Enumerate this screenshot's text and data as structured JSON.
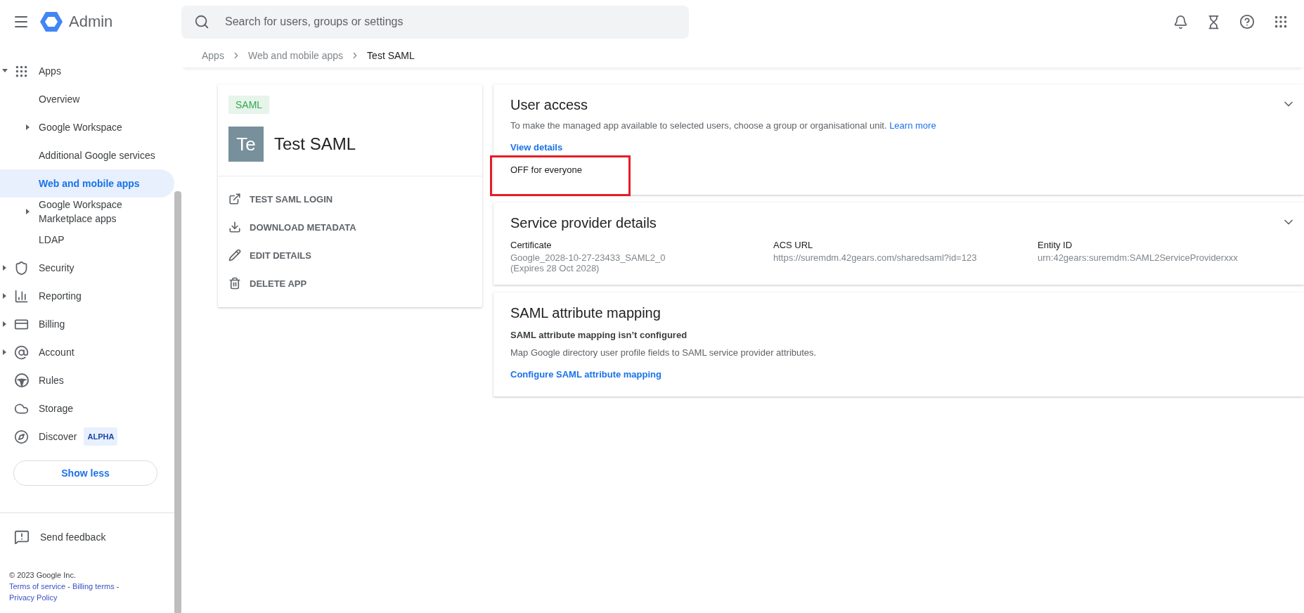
{
  "app_bar": {
    "product": "Admin",
    "search": {
      "placeholder": "Search for users, groups or settings"
    }
  },
  "sidebar": {
    "items": [
      {
        "label": "Apps",
        "kind": "grid",
        "expandable": true,
        "expanded": true,
        "selected": false,
        "children": [
          {
            "label": "Overview",
            "expandable": false,
            "selected": false
          },
          {
            "label": "Google Workspace",
            "expandable": true,
            "selected": false
          },
          {
            "label": "Additional Google services",
            "expandable": false,
            "selected": false
          },
          {
            "label": "Web and mobile apps",
            "expandable": false,
            "selected": true
          },
          {
            "label": "Google Workspace\nMarketplace apps",
            "expandable": true,
            "selected": false
          },
          {
            "label": "LDAP",
            "expandable": false,
            "selected": false
          }
        ]
      },
      {
        "label": "Security",
        "kind": "shield",
        "expandable": true,
        "expanded": false,
        "selected": false
      },
      {
        "label": "Reporting",
        "kind": "bars",
        "expandable": true,
        "expanded": false,
        "selected": false
      },
      {
        "label": "Billing",
        "kind": "card",
        "expandable": true,
        "expanded": false,
        "selected": false
      },
      {
        "label": "Account",
        "kind": "at",
        "expandable": true,
        "expanded": false,
        "selected": false
      },
      {
        "label": "Rules",
        "kind": "wheel",
        "expandable": false,
        "selected": false
      },
      {
        "label": "Storage",
        "kind": "cloud",
        "expandable": false,
        "selected": false
      },
      {
        "label": "Discover",
        "kind": "compass",
        "expandable": false,
        "selected": false,
        "badge": "ALPHA"
      }
    ],
    "show_less": "Show less",
    "feedback": "Send feedback",
    "footer": {
      "copyright": "© 2023 Google Inc.",
      "links": [
        "Terms of service",
        "Billing terms",
        "Privacy Policy"
      ],
      "separator": "-"
    }
  },
  "breadcrumb": [
    "Apps",
    "Web and mobile apps",
    "Test SAML"
  ],
  "app_card": {
    "tag": "SAML",
    "avatar": "Te",
    "name": "Test SAML",
    "actions": [
      {
        "label": "TEST SAML LOGIN",
        "kind": "external"
      },
      {
        "label": "DOWNLOAD METADATA",
        "kind": "download"
      },
      {
        "label": "EDIT DETAILS",
        "kind": "pencil"
      },
      {
        "label": "DELETE APP",
        "kind": "trash"
      }
    ]
  },
  "user_access": {
    "title": "User access",
    "text": "To make the managed app available to selected users, choose a group or organisational unit.",
    "link": "Learn more",
    "details_link": "View details",
    "status": "OFF for everyone",
    "status_highlighted": true
  },
  "service_provider": {
    "title": "Service provider details",
    "fields": [
      {
        "label": "Certificate",
        "value": "Google_2028-10-27-23433_SAML2_0",
        "note": "(Expires 28 Oct 2028)"
      },
      {
        "label": "ACS URL",
        "value": "https://suremdm.42gears.com/sharedsaml?id=123"
      },
      {
        "label": "Entity ID",
        "value": "urn:42gears:suremdm:SAML2ServiceProviderxxx"
      }
    ]
  },
  "attribute_mapping": {
    "title": "SAML attribute mapping",
    "subtitle": "SAML attribute mapping isn’t configured",
    "text": "Map Google directory user profile fields to SAML service provider attributes.",
    "link": "Configure SAML attribute mapping"
  }
}
